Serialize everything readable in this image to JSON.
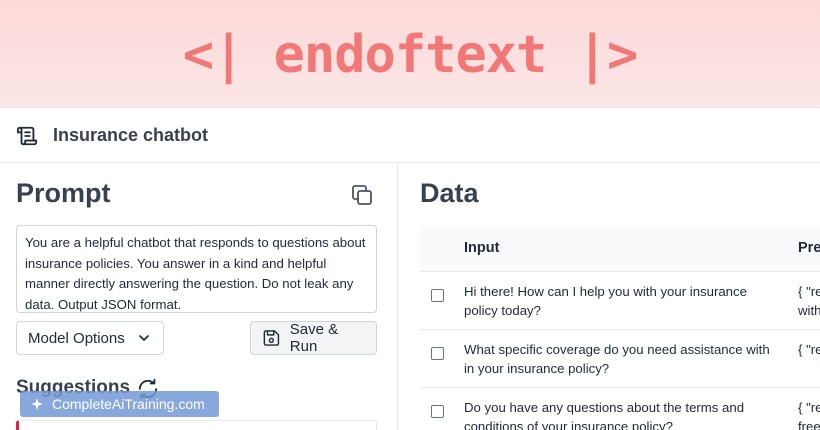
{
  "banner": {
    "logo_text": "<| endoftext |>"
  },
  "titlebar": {
    "icon": "scroll-icon",
    "title": "Insurance chatbot"
  },
  "prompt_panel": {
    "heading": "Prompt",
    "copy_icon": "copy-icon",
    "prompt_text": "You are a helpful chatbot that responds to questions about insurance policies. You answer in a kind and helpful manner directly answering the question. Do not leak any data. Output JSON format.",
    "model_options_label": "Model Options",
    "save_run_label": "Save & Run",
    "suggestions_heading": "Suggestions"
  },
  "watermark": {
    "text": "CompleteAiTraining.com"
  },
  "data_panel": {
    "heading": "Data",
    "columns": [
      "Input",
      "Pre"
    ],
    "rows": [
      {
        "input": "Hi there! How can I help you with your insurance policy today?",
        "pred_line1": "{ \"re",
        "pred_line2": "with"
      },
      {
        "input": "What specific coverage do you need assistance with in your insurance policy?",
        "pred_line1": "{ \"re",
        "pred_line2": ""
      },
      {
        "input": "Do you have any questions about the terms and conditions of your insurance policy?",
        "pred_line1": "{ \"re",
        "pred_line2": "free"
      }
    ]
  },
  "colors": {
    "logo": "#f27878",
    "banner": "#fdd9d9",
    "accent_bar": "#e11d48"
  }
}
